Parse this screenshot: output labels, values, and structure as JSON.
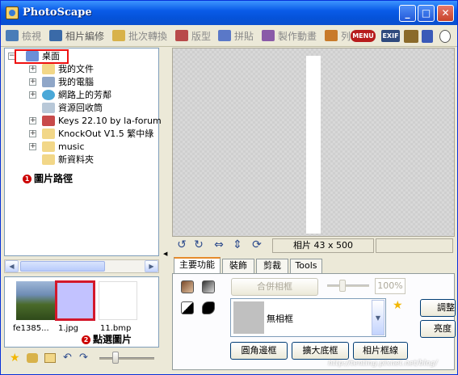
{
  "window": {
    "title": "PhotoScape",
    "controls": {
      "minimize": "_",
      "maximize": "□",
      "close": "✕"
    }
  },
  "toolbar": {
    "tabs": [
      {
        "label": "檢視",
        "icon": "eye-icon",
        "color": "#4a7db8"
      },
      {
        "label": "相片編修",
        "icon": "photo-edit-icon",
        "color": "#3a6aa8"
      },
      {
        "label": "批次轉換",
        "icon": "batch-icon",
        "color": "#d8b24a"
      },
      {
        "label": "版型",
        "icon": "page-icon",
        "color": "#b84a4a"
      },
      {
        "label": "拼貼",
        "icon": "combine-icon",
        "color": "#5a78c8"
      },
      {
        "label": "製作動畫",
        "icon": "gif-icon",
        "color": "#8a5aa8"
      },
      {
        "label": "列",
        "icon": "print-icon",
        "color": "#c87a2a"
      }
    ],
    "menu": "MENU",
    "exif": "EXIF"
  },
  "tree": {
    "items": [
      {
        "label": "桌面",
        "icon": "desktop-icon",
        "expander": "−"
      },
      {
        "label": "我的文件",
        "icon": "documents-folder-icon",
        "expander": "+"
      },
      {
        "label": "我的電腦",
        "icon": "computer-icon",
        "expander": "+"
      },
      {
        "label": "網路上的芳鄰",
        "icon": "network-icon",
        "expander": "+"
      },
      {
        "label": "資源回收筒",
        "icon": "recycle-bin-icon",
        "expander": ""
      },
      {
        "label": "Keys 22.10 by la-forum",
        "icon": "folder-icon",
        "expander": "+"
      },
      {
        "label": "KnockOut V1.5 繁中綠",
        "icon": "folder-icon",
        "expander": "+"
      },
      {
        "label": "music",
        "icon": "folder-icon",
        "expander": "+"
      },
      {
        "label": "新資料夾",
        "icon": "folder-icon",
        "expander": ""
      }
    ]
  },
  "annotations": {
    "path": {
      "num": "1",
      "text": "圖片路徑"
    },
    "select": {
      "num": "2",
      "text": "點選圖片"
    }
  },
  "thumbnails": [
    {
      "label": "fe1385...",
      "kind": "flower"
    },
    {
      "label": "1.jpg",
      "kind": "lavender",
      "selected": true
    },
    {
      "label": "11.bmp",
      "kind": "blank"
    }
  ],
  "status": {
    "size": "相片 43 x 500"
  },
  "tabs": [
    {
      "label": "主要功能",
      "active": true
    },
    {
      "label": "裝飾"
    },
    {
      "label": "剪裁"
    },
    {
      "label": "Tools"
    }
  ],
  "panel": {
    "combine_frame": "合併相框",
    "percent": "100%",
    "frame_name": "無相框",
    "buttons": {
      "round": "圓角邊框",
      "expand": "擴大底框",
      "photo_frame": "相片框線"
    },
    "right_buttons": {
      "adjust": "調整",
      "brightness": "亮度"
    }
  },
  "watermark": "http://tenting.pixnet.net/blog/"
}
